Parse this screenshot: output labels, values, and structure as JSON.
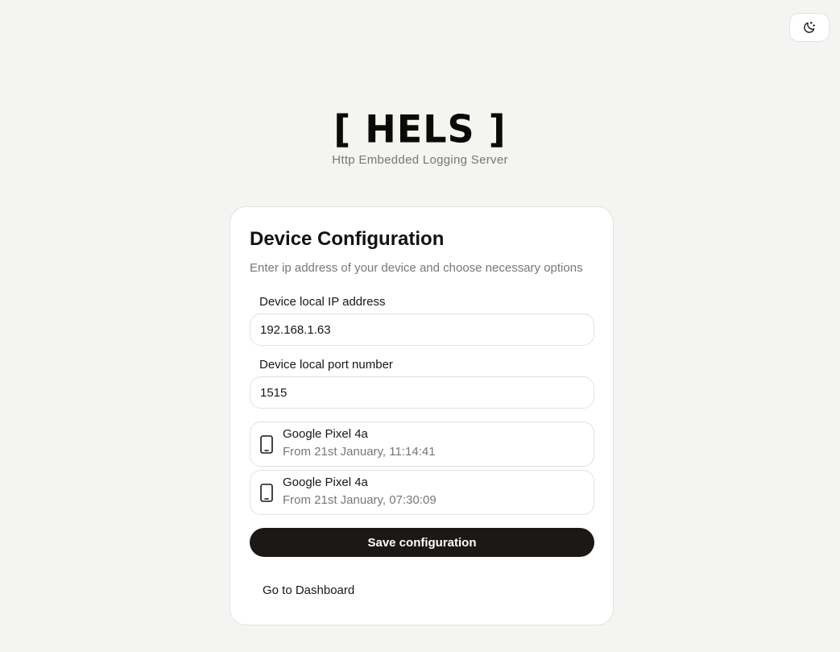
{
  "header": {
    "theme_toggle_icon": "moon-stars-icon"
  },
  "brand": {
    "title": "[ HELS ]",
    "subtitle": "Http Embedded Logging Server"
  },
  "config": {
    "title": "Device Configuration",
    "description": "Enter ip address of your device and choose necessary options",
    "ip_label": "Device local IP address",
    "ip_value": "192.168.1.63",
    "port_label": "Device local port number",
    "port_value": "1515",
    "devices": [
      {
        "icon": "phone-icon",
        "name": "Google Pixel 4a",
        "time": "From 21st January, 11:14:41"
      },
      {
        "icon": "phone-icon",
        "name": "Google Pixel 4a",
        "time": "From 21st January, 07:30:09"
      }
    ],
    "save_label": "Save configuration",
    "dashboard_label": "Go to Dashboard"
  },
  "colors": {
    "background": "#f4f4f2",
    "card": "#ffffff",
    "primary_button": "#1c1816",
    "muted_text": "#7b7672",
    "border": "#e4e2df"
  }
}
